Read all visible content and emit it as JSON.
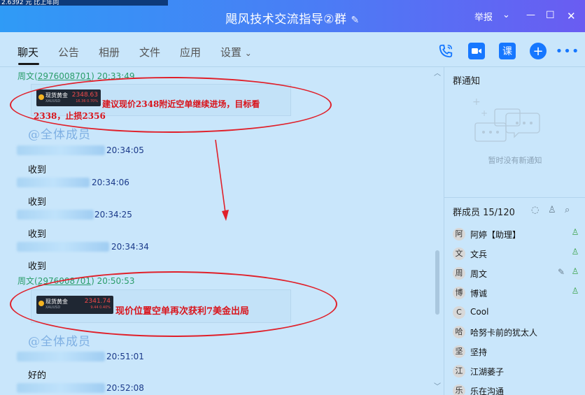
{
  "window": {
    "title": "飓风技术交流指导②群",
    "edit_icon": "pencil-icon",
    "report_label": "举报",
    "top_strip_text": "2.6392 元 比上年同"
  },
  "tabs": [
    {
      "label": "聊天",
      "active": true
    },
    {
      "label": "公告"
    },
    {
      "label": "相册"
    },
    {
      "label": "文件"
    },
    {
      "label": "应用"
    },
    {
      "label": "设置"
    }
  ],
  "toolbar_icons": [
    "phone-icon",
    "video-icon",
    "course-icon",
    "add-icon",
    "more-icon"
  ],
  "course_label": "课",
  "chat": {
    "messages": [
      {
        "sender": "周文",
        "sender_id": "2976008701",
        "time": "20:33:49",
        "card": {
          "name": "现货黄金",
          "sub": "XAUUSD",
          "price": "2348.63",
          "change": "16.36  0.70%"
        },
        "text": "建议现价2348附近空单继续进场，目标看2338，止损2356"
      },
      {
        "at_all": "@全体成员"
      },
      {
        "time": "20:34:05",
        "text": "收到"
      },
      {
        "time": "20:34:06",
        "text": "收到"
      },
      {
        "time": "20:34:25",
        "text": "收到"
      },
      {
        "time": "20:34:34",
        "text": "收到"
      },
      {
        "sender": "周文",
        "sender_id": "2976008701",
        "time": "20:50:53",
        "card": {
          "name": "现货黄金",
          "sub": "XAUUSD",
          "price": "2341.74",
          "change": "9.44  0.40%"
        },
        "text": "现价位置空单再次获利7美金出局"
      },
      {
        "at_all": "@全体成员"
      },
      {
        "time": "20:51:01",
        "text": "好的"
      },
      {
        "time": "20:52:08"
      }
    ]
  },
  "right_panel": {
    "notice_title": "群通知",
    "notice_empty": "暂时没有新通知",
    "members_title": "群成员 15/120",
    "members": [
      {
        "name": "阿婷【助理】",
        "avatar": "阿"
      },
      {
        "name": "文兵",
        "avatar": "文"
      },
      {
        "name": "周文",
        "avatar": "周"
      },
      {
        "name": "博诚",
        "avatar": "博"
      },
      {
        "name": "Cool",
        "avatar": "C"
      },
      {
        "name": "哈努卡前的犹太人",
        "avatar": "哈"
      },
      {
        "name": "坚持",
        "avatar": "坚"
      },
      {
        "name": "江湖萎子",
        "avatar": "江"
      },
      {
        "name": "乐在沟通",
        "avatar": "乐"
      }
    ]
  },
  "colors": {
    "accent": "#1677ff",
    "annotation": "#e0202a",
    "background": "#c9e6fb"
  }
}
